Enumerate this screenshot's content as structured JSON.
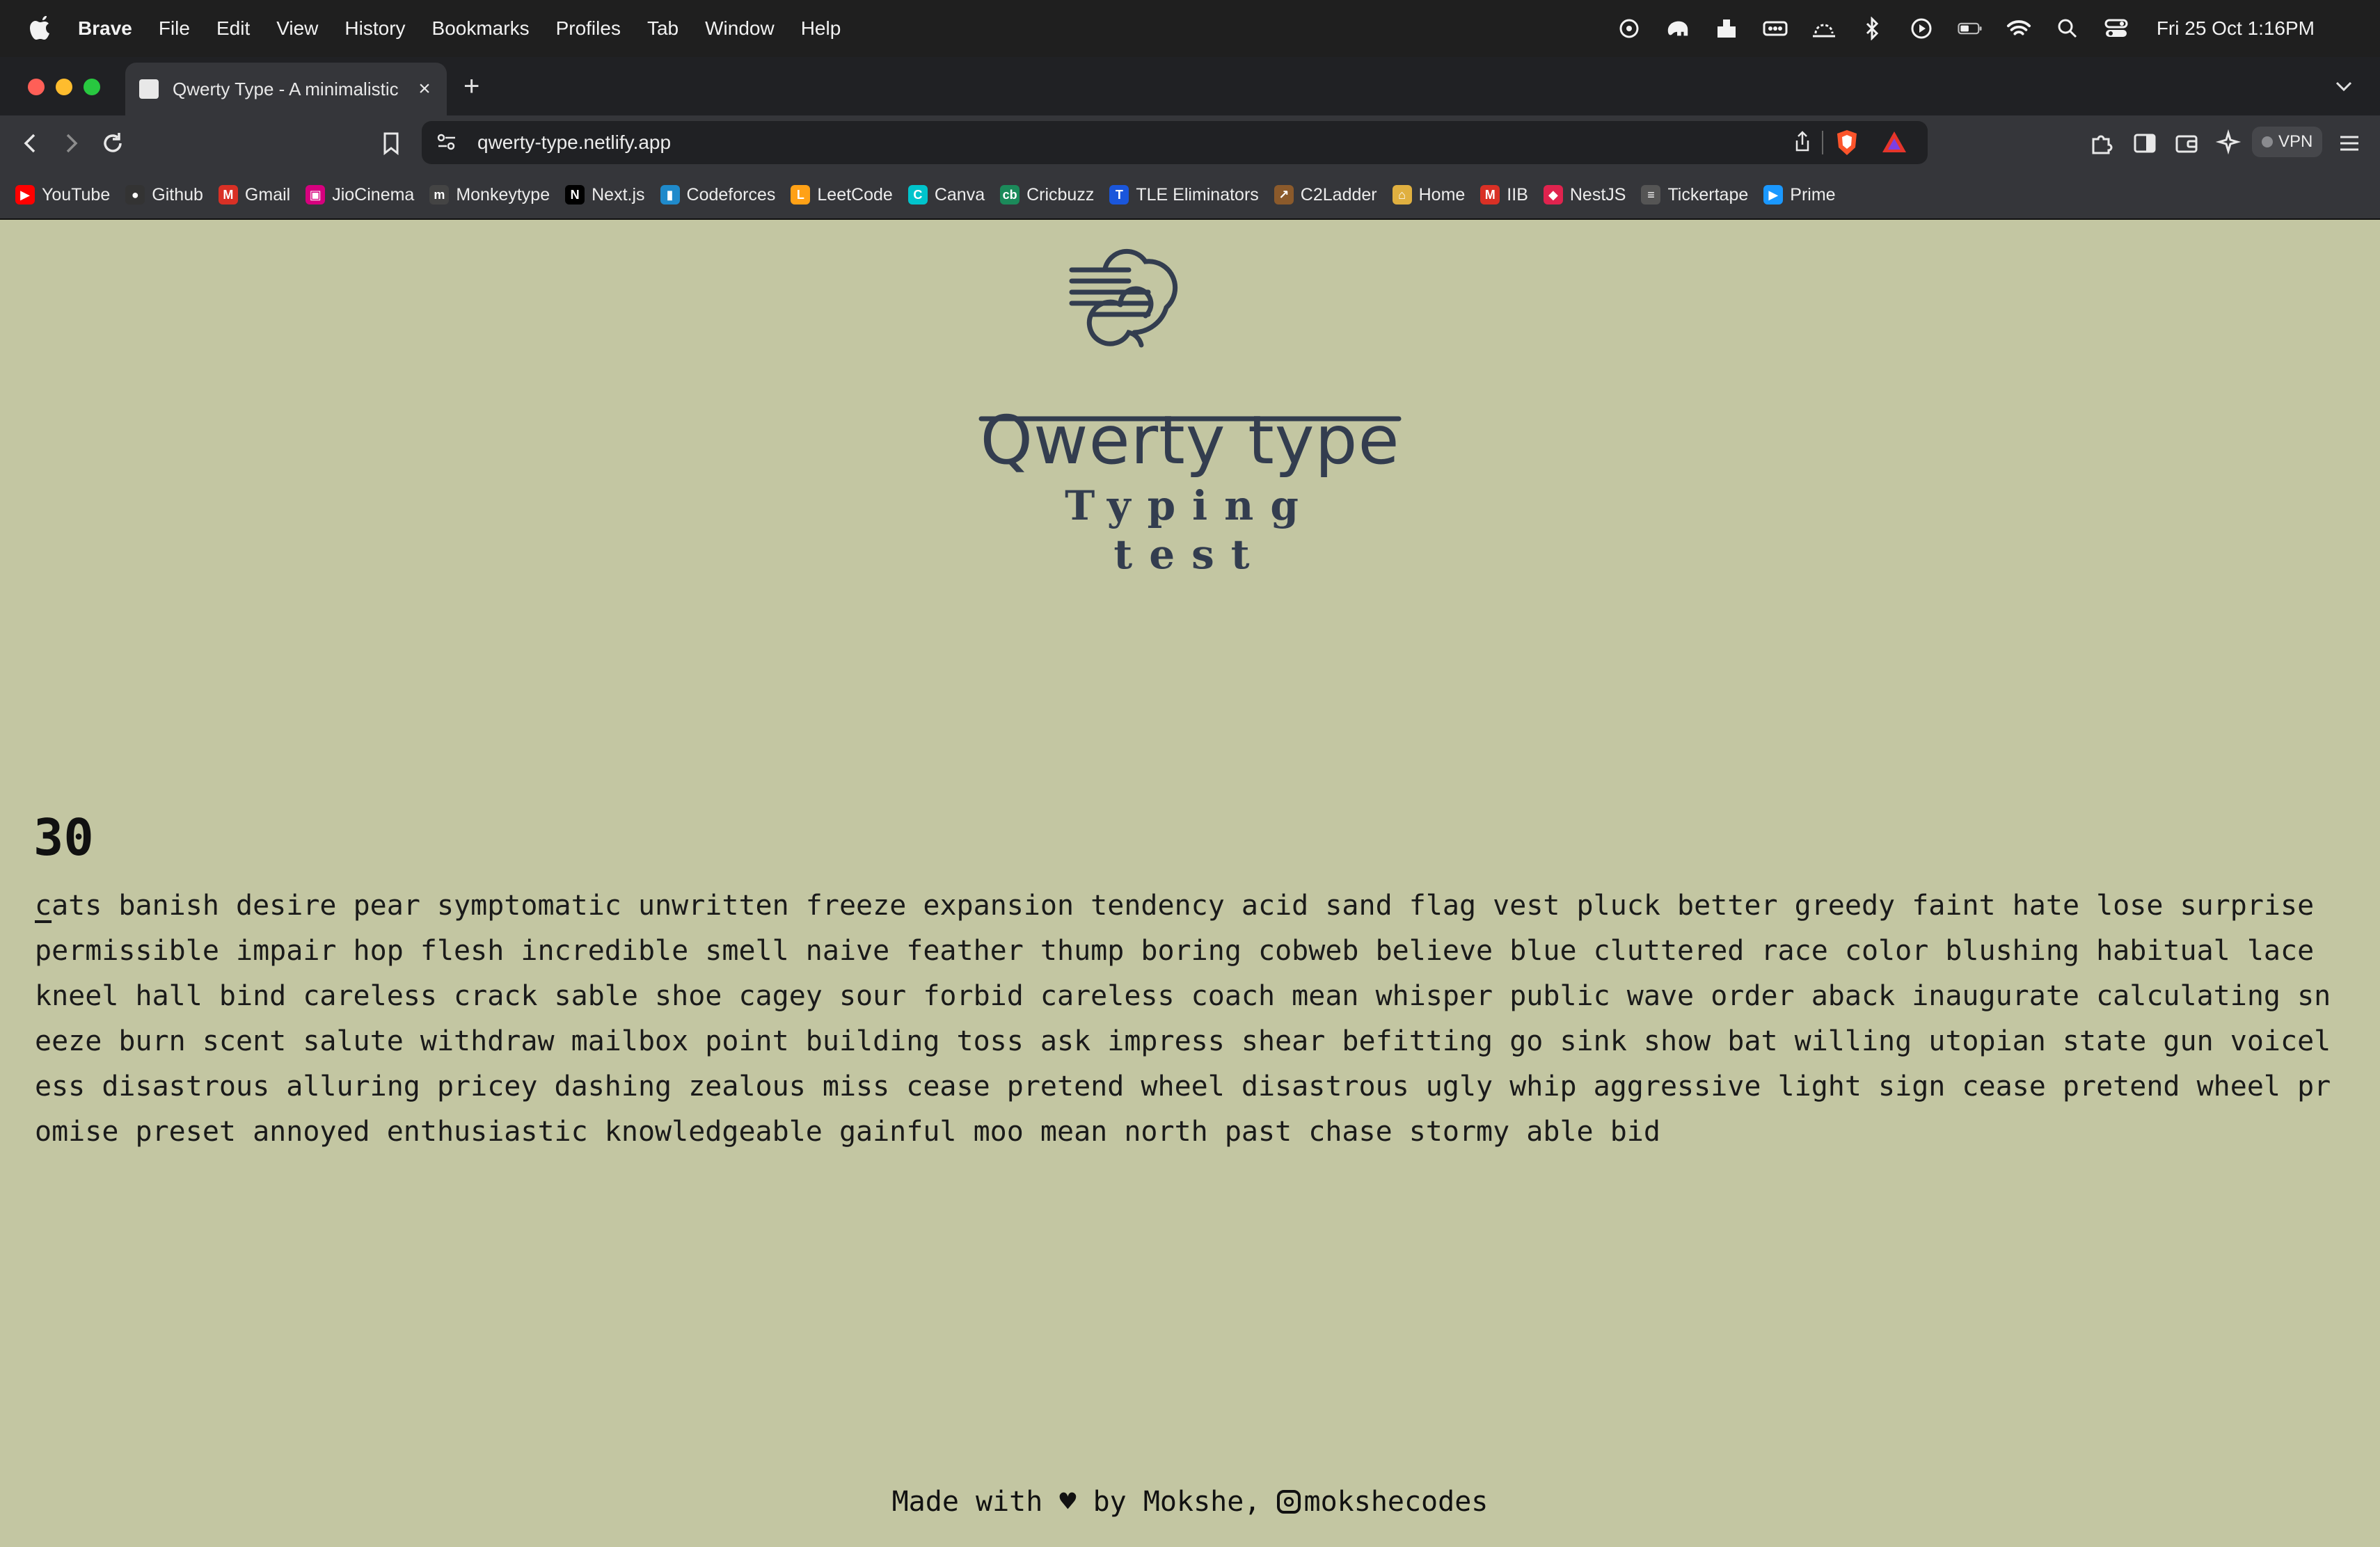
{
  "menubar": {
    "app": "Brave",
    "items": [
      "File",
      "Edit",
      "View",
      "History",
      "Bookmarks",
      "Profiles",
      "Tab",
      "Window",
      "Help"
    ],
    "clock": "Fri 25 Oct  1:16PM",
    "status_icons": [
      "chatgpt-icon",
      "elephant-icon",
      "inbox-icon",
      "battery-dots-icon",
      "sunset-icon",
      "bluetooth-icon",
      "play-icon",
      "battery-icon",
      "wifi-icon",
      "spotlight-icon",
      "control-center-icon"
    ]
  },
  "tab": {
    "title": "Qwerty Type - A minimalistic",
    "close": "×",
    "new_tab": "+"
  },
  "address": {
    "url": "qwerty-type.netlify.app"
  },
  "toolbar": {
    "vpn_label": "VPN"
  },
  "bookmarks": [
    {
      "label": "YouTube",
      "icon": "youtube-icon",
      "color": "#ff0000",
      "glyph": "▶"
    },
    {
      "label": "Github",
      "icon": "github-icon",
      "color": "#333333",
      "glyph": "●"
    },
    {
      "label": "Gmail",
      "icon": "gmail-icon",
      "color": "#d93025",
      "glyph": "M"
    },
    {
      "label": "JioCinema",
      "icon": "jiocinema-icon",
      "color": "#d6007e",
      "glyph": "▣"
    },
    {
      "label": "Monkeytype",
      "icon": "monkeytype-icon",
      "color": "#444444",
      "glyph": "m"
    },
    {
      "label": "Next.js",
      "icon": "nextjs-icon",
      "color": "#000000",
      "glyph": "N"
    },
    {
      "label": "Codeforces",
      "icon": "codeforces-icon",
      "color": "#1f8acb",
      "glyph": "▮"
    },
    {
      "label": "LeetCode",
      "icon": "leetcode-icon",
      "color": "#ffa116",
      "glyph": "L"
    },
    {
      "label": "Canva",
      "icon": "canva-icon",
      "color": "#00c4cc",
      "glyph": "C"
    },
    {
      "label": "Cricbuzz",
      "icon": "cricbuzz-icon",
      "color": "#1b8a5a",
      "glyph": "cb"
    },
    {
      "label": "TLE Eliminators",
      "icon": "tle-icon",
      "color": "#1a56db",
      "glyph": "T"
    },
    {
      "label": "C2Ladder",
      "icon": "c2ladder-icon",
      "color": "#8b5a2b",
      "glyph": "↗"
    },
    {
      "label": "Home",
      "icon": "home-icon",
      "color": "#e0b040",
      "glyph": "⌂"
    },
    {
      "label": "IIB",
      "icon": "iib-icon",
      "color": "#d93025",
      "glyph": "M"
    },
    {
      "label": "NestJS",
      "icon": "nestjs-icon",
      "color": "#e0234e",
      "glyph": "◆"
    },
    {
      "label": "Tickertape",
      "icon": "tickertape-icon",
      "color": "#555555",
      "glyph": "≡"
    },
    {
      "label": "Prime",
      "icon": "prime-icon",
      "color": "#1a98ff",
      "glyph": "▶"
    }
  ],
  "page": {
    "brand_name": "Qwerty type",
    "brand_tagline": "Typing test",
    "timer": "30",
    "words": "cats banish desire pear symptomatic unwritten freeze expansion tendency acid sand flag vest pluck better greedy faint hate lose surprise permissible impair hop flesh incredible smell naive feather thump boring cobweb believe blue cluttered race color blushing habitual lace kneel hall bind careless crack sable shoe cagey sour forbid careless coach mean whisper public wave order aback inaugurate calculating sneeze burn scent salute withdraw mailbox point building toss ask impress shear befitting go sink show bat willing utopian state gun voiceless disastrous alluring pricey dashing zealous miss cease pretend wheel disastrous ugly whip aggressive light sign cease pretend wheel promise preset annoyed enthusiastic knowledgeable gainful moo mean north past chase stormy able bid",
    "footer_prefix": "Made with ♥ by Mokshe, ",
    "footer_handle": "mokshecodes"
  },
  "colors": {
    "page_bg": "#c3c6a2",
    "brand": "#333d4f",
    "close_dot": "#ff5f57",
    "minimize_dot": "#febc2e",
    "zoom_dot": "#28c840"
  }
}
